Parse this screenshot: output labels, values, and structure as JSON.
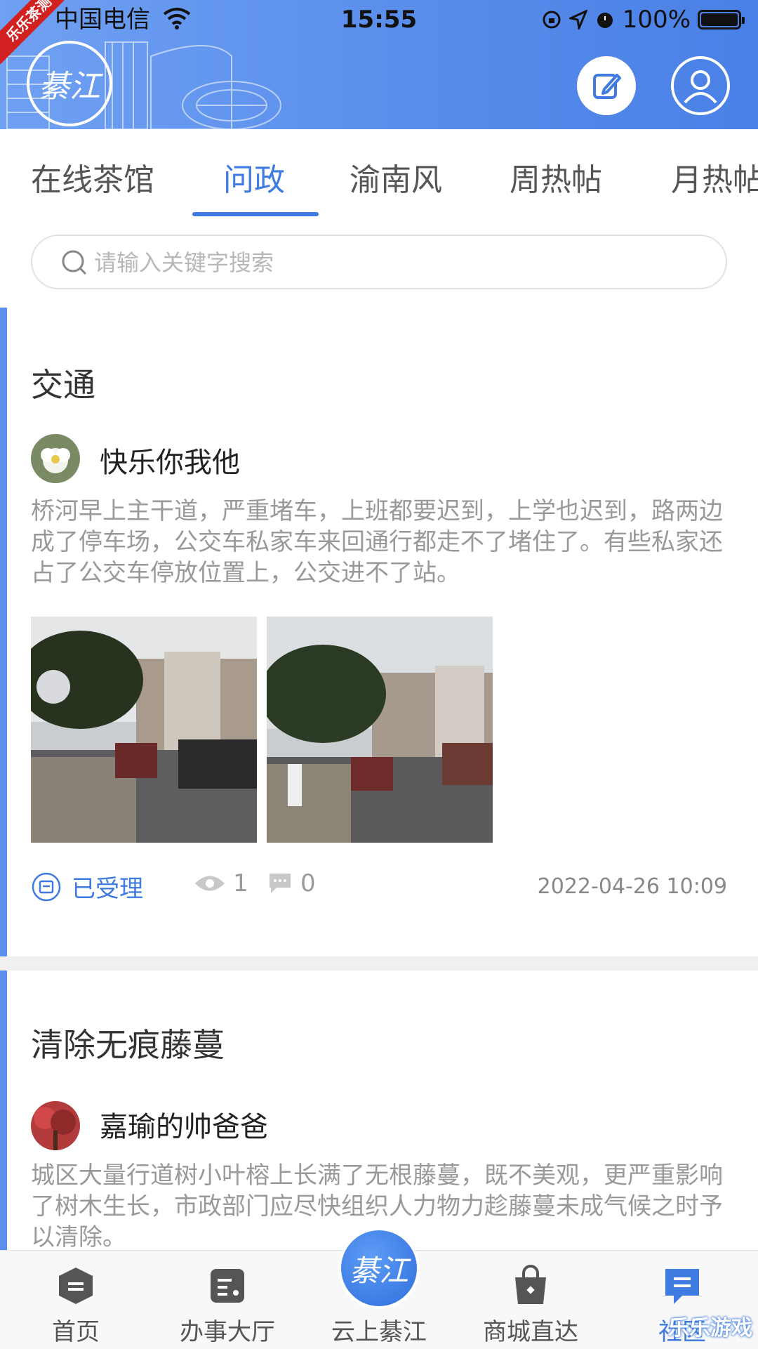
{
  "status_bar": {
    "carrier": "中国电信",
    "time": "15:55",
    "battery": "100%"
  },
  "header": {
    "ribbon": "乐乐茶测",
    "logo_text": "綦江"
  },
  "tabs": [
    "在线茶馆",
    "问政",
    "渝南风",
    "周热帖",
    "月热帖"
  ],
  "active_tab": "问政",
  "search": {
    "placeholder": "请输入关键字搜索",
    "value": ""
  },
  "posts": [
    {
      "title": "交通",
      "author": "快乐你我他",
      "body": "桥河早上主干道，严重堵车，上班都要迟到，上学也迟到，路两边成了停车场，公交车私家车来回通行都走不了堵住了。有些私家还占了公交车停放位置上，公交进不了站。",
      "status": "已受理",
      "views": "1",
      "comments": "0",
      "timestamp": "2022-04-26 10:09"
    },
    {
      "title": "清除无痕藤蔓",
      "author": "嘉瑜的帅爸爸",
      "body": "城区大量行道树小叶榕上长满了无根藤蔓，既不美观，更严重影响了树木生长，市政部门应尽快组织人力物力趁藤蔓未成气候之时予以清除。"
    }
  ],
  "bottom_nav": {
    "items": [
      "首页",
      "办事大厅",
      "云上綦江",
      "商城直达",
      "社区"
    ],
    "center_logo": "綦江"
  },
  "watermark": "乐乐游戏",
  "colors": {
    "accent": "#3f7be0",
    "header": "#5b8fec"
  }
}
